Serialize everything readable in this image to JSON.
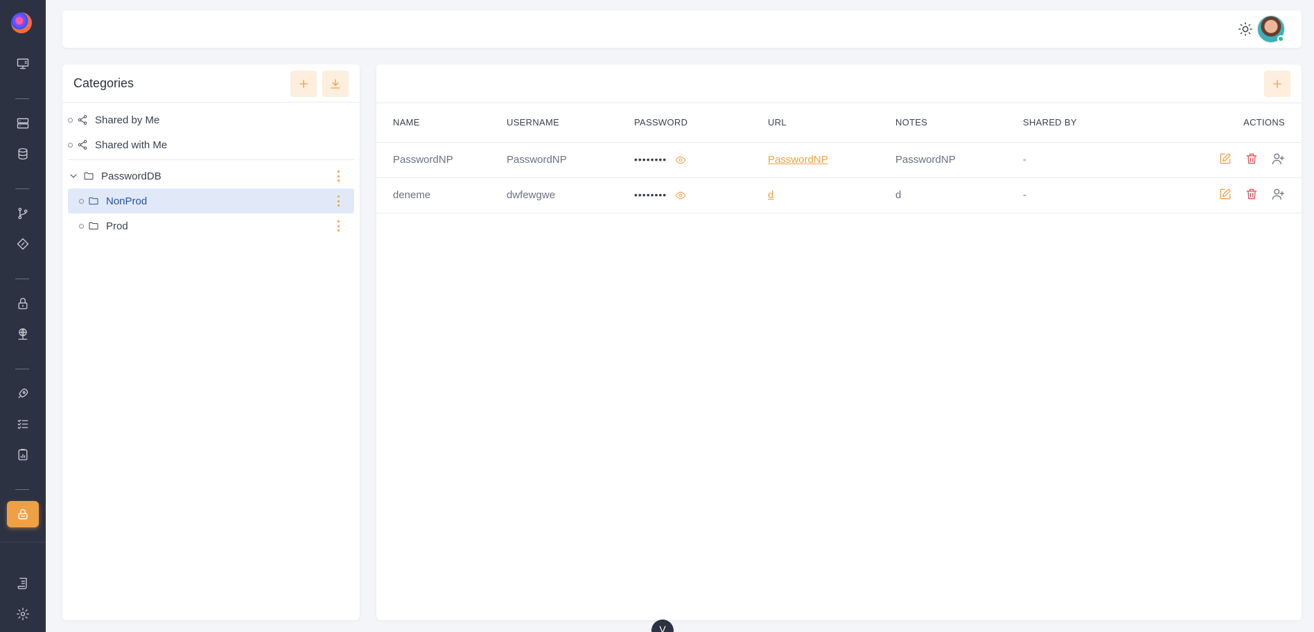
{
  "sidebar": {
    "items": [
      {
        "icon": "desktop-icon"
      },
      {
        "icon": "server-icon"
      },
      {
        "icon": "database-icon"
      },
      {
        "icon": "git-branch-icon"
      },
      {
        "icon": "diamond-icon"
      },
      {
        "icon": "lock-icon"
      },
      {
        "icon": "globe-network-icon"
      },
      {
        "icon": "rocket-icon"
      },
      {
        "icon": "checklist-icon"
      },
      {
        "icon": "clipboard-icon"
      },
      {
        "icon": "password-vault-icon",
        "active": true
      },
      {
        "icon": "report-icon"
      },
      {
        "icon": "gear-icon"
      }
    ]
  },
  "categories": {
    "title": "Categories",
    "shared_by_me": "Shared by Me",
    "shared_with_me": "Shared with Me",
    "db": "PasswordDB",
    "folders": [
      "NonProd",
      "Prod"
    ],
    "selected": "NonProd"
  },
  "table": {
    "headers": [
      "NAME",
      "USERNAME",
      "PASSWORD",
      "URL",
      "NOTES",
      "SHARED BY",
      "ACTIONS"
    ],
    "rows": [
      {
        "name": "PasswordNP",
        "username": "PasswordNP",
        "password": "••••••••",
        "url": "PasswordNP",
        "notes": "PasswordNP",
        "shared_by": "-"
      },
      {
        "name": "deneme",
        "username": "dwfewgwe",
        "password": "••••••••",
        "url": "d",
        "notes": "d",
        "shared_by": "-"
      }
    ]
  },
  "bottom_tab": "V",
  "colors": {
    "accent": "#f0a044",
    "danger": "#ea4d57",
    "sidebar": "#2d3242",
    "selected": "#e1e9f9"
  }
}
